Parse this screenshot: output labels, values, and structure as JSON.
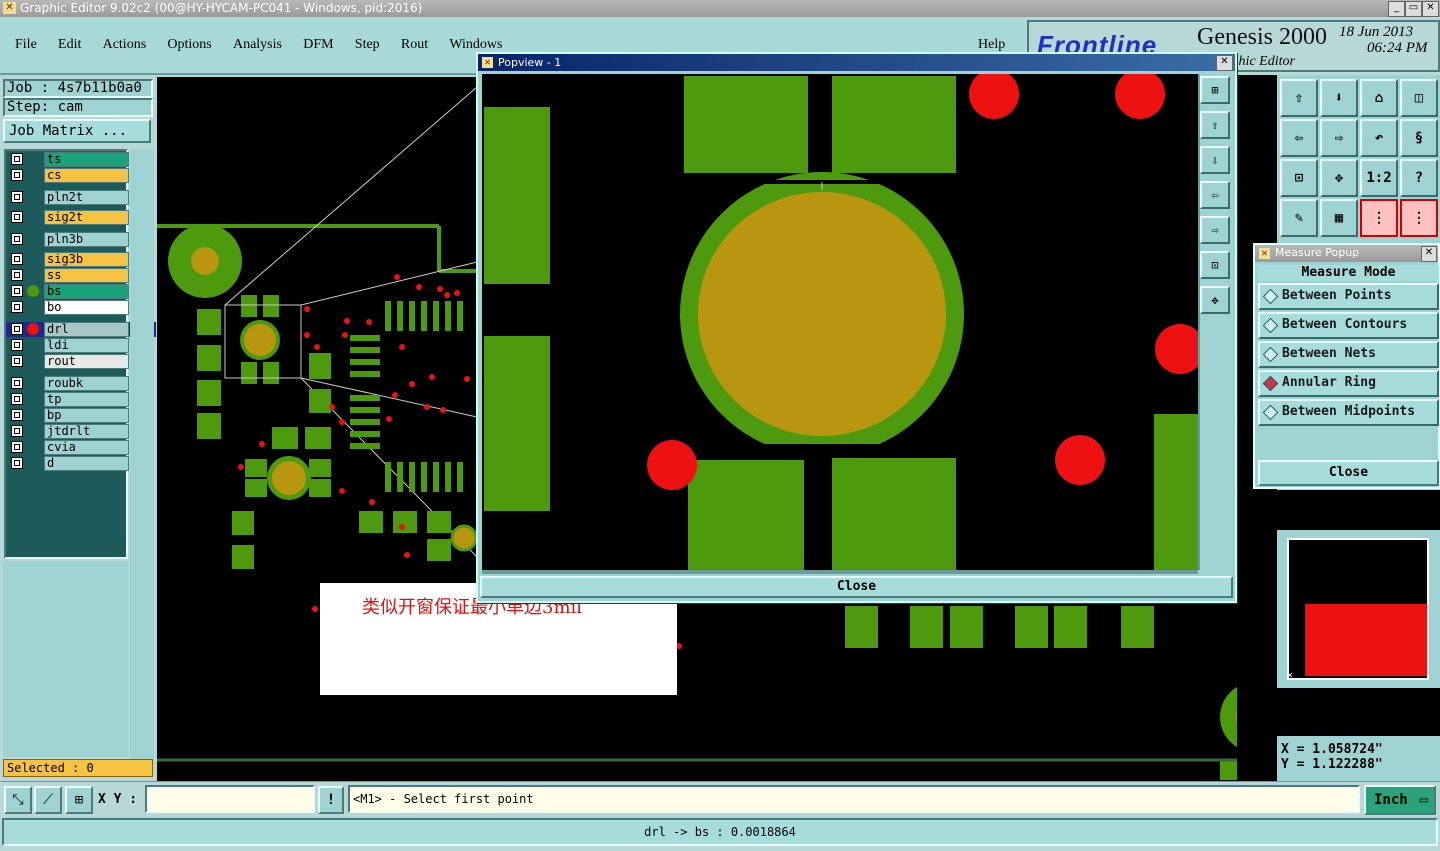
{
  "window": {
    "title": "Graphic Editor 9.02c2 (00@HY-HYCAM-PC041 - Windows, pid:2016)"
  },
  "menu": [
    "File",
    "Edit",
    "Actions",
    "Options",
    "Analysis",
    "DFM",
    "Step",
    "Rout",
    "Windows",
    "Help"
  ],
  "branding": {
    "logo": "Frontline",
    "product": "Genesis 2000",
    "subtitle": "Graphic Editor",
    "date": "18 Jun 2013",
    "time": "06:24 PM"
  },
  "job": {
    "job_label": "Job : 4s7b11b0a0",
    "step_label": "Step: cam",
    "matrix_button": "Job Matrix ..."
  },
  "layers": [
    {
      "name": "ts",
      "color": "#1aa37a"
    },
    {
      "name": "cs",
      "color": "#f5c242"
    },
    {
      "name": "pln2t",
      "color": "#9fd3d3"
    },
    {
      "name": "sig2t",
      "color": "#f5c242"
    },
    {
      "name": "pln3b",
      "color": "#9fd3d3"
    },
    {
      "name": "sig3b",
      "color": "#f5c242"
    },
    {
      "name": "ss",
      "color": "#f5c242"
    },
    {
      "name": "bs",
      "color": "#1aa37a"
    },
    {
      "name": "bo",
      "color": "#ffffff"
    },
    {
      "name": "drl",
      "color": "#a8c8c8"
    },
    {
      "name": "ldi",
      "color": "#9fd3d3"
    },
    {
      "name": "rout",
      "color": "#e8e8e8"
    },
    {
      "name": "roubk",
      "color": "#9fd3d3"
    },
    {
      "name": "tp",
      "color": "#9fd3d3"
    },
    {
      "name": "bp",
      "color": "#9fd3d3"
    },
    {
      "name": "jtdrlt",
      "color": "#9fd3d3"
    },
    {
      "name": "cvia",
      "color": "#9fd3d3"
    },
    {
      "name": "d",
      "color": "#9fd3d3"
    }
  ],
  "selected_label": "Selected : 0",
  "popview": {
    "title": "Popview - 1",
    "close_label": "Close"
  },
  "annotation": {
    "text": "类似开窗保证最小单边3mil"
  },
  "measure": {
    "title": "Measure Popup",
    "header": "Measure Mode",
    "modes": [
      "Between Points",
      "Between Contours",
      "Between Nets",
      "Annular Ring",
      "Between Midpoints"
    ],
    "selected_mode": "Annular Ring",
    "close_label": "Close"
  },
  "coords": {
    "x": "X  =  1.058724\"",
    "y": "Y  =  1.122288\""
  },
  "bottom": {
    "xy_label": "X Y :",
    "xy_value": "",
    "prompt": "<M1> - Select first point",
    "units": "Inch",
    "status": "drl -> bs : 0.0018864"
  },
  "colors": {
    "copper": "#4d9a0f",
    "drill": "#ee1111",
    "pad_core": "#b8960f",
    "panel": "#9fd3d3"
  }
}
